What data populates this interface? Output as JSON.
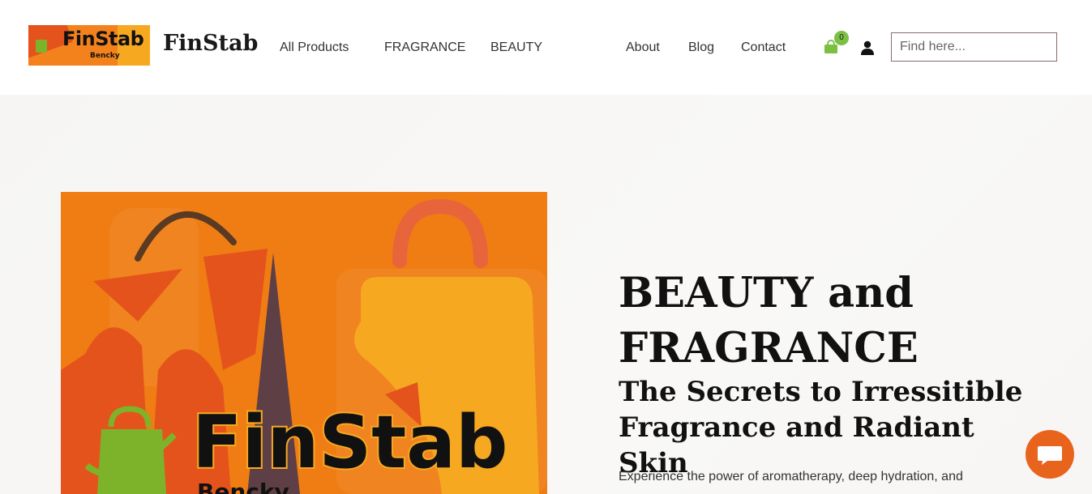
{
  "header": {
    "logo": {
      "text": "FinStab",
      "subtext": "Bencky"
    },
    "site_title": "FinStab",
    "nav_left": [
      "All Products",
      "FRAGRANCE",
      "BEAUTY"
    ],
    "nav_right": [
      "About",
      "Blog",
      "Contact"
    ],
    "cart": {
      "icon": "shopping-bag-icon",
      "count": "0"
    },
    "user_icon": "user-icon",
    "search": {
      "placeholder": "Find here...",
      "value": ""
    }
  },
  "hero": {
    "image": {
      "brand_text": "FinStab",
      "brand_sub": "Bencky"
    },
    "title_line1": "BEAUTY and",
    "title_line2": "FRAGRANCE",
    "subtitle_line1": "The Secrets to Irressitible",
    "subtitle_line2": "Fragrance and Radiant Skin",
    "description": "Experience the power of aromatherapy, deep hydration, and"
  },
  "chat": {
    "icon": "chat-bubble-icon"
  },
  "colors": {
    "accent_orange": "#e8641d",
    "cart_green": "#7ac143",
    "hero_bg": "#f7f6f4",
    "image_orange": "#ef7d14"
  }
}
